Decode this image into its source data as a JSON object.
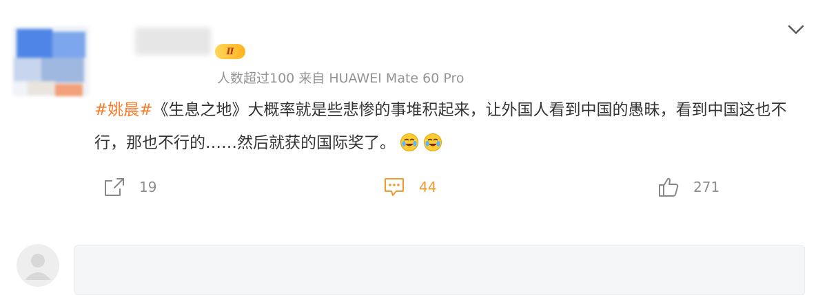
{
  "post": {
    "vip_label": "Ⅱ",
    "meta_text": "人数超过100  来自 HUAWEI Mate 60 Pro",
    "hashtag": "#姚晨#",
    "body": "《生息之地》大概率就是些悲惨的事堆积起来，让外国人看到中国的愚昧，看到中国这也不行，那也不行的……然后就获的国际奖了。"
  },
  "actions": {
    "repost_count": "19",
    "comment_count": "44",
    "like_count": "271"
  },
  "icons": {
    "menu": "chevron-down-icon",
    "repost": "share-icon",
    "comment": "comment-icon",
    "like": "thumbs-up-icon",
    "emoji": "laugh-cry-emoji"
  },
  "colors": {
    "hashtag": "#f47d2c",
    "comment_accent": "#f39a2e",
    "meta": "#939393"
  }
}
